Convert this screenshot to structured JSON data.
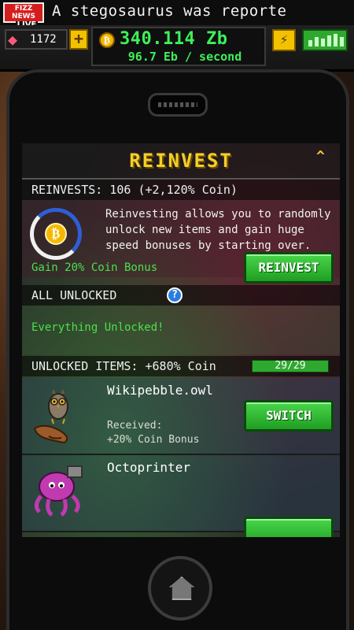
{
  "news": {
    "logo_top": "FIZZ NEWS",
    "logo_bottom": "LIVE",
    "ticker": "A stegosaurus was reporte"
  },
  "stats": {
    "gems": "1172",
    "plus": "+",
    "coin_total": "340.114 Zb",
    "coin_rate": "96.7 Eb / second",
    "boost_icon": "lightning-icon",
    "chart_icon": "bar-chart-icon"
  },
  "reinvest": {
    "title": "REINVEST",
    "collapse_symbol": "^",
    "count_label": "REINVESTS: 106 (+2,120% Coin)",
    "description": "Reinvesting allows you to randomly unlock new items and gain huge speed bonuses by starting over.",
    "gain": "Gain 20% Coin Bonus",
    "button": "REINVEST"
  },
  "all_unlocked": {
    "label": "ALL UNLOCKED",
    "help": "?",
    "status": "Everything Unlocked!"
  },
  "unlocked_items": {
    "label": "UNLOCKED ITEMS: +680% Coin",
    "progress": "29/29",
    "items": [
      {
        "name": "Wikipebble.owl",
        "received_label": "Received:",
        "bonus": "+20% Coin Bonus",
        "button": "SWITCH",
        "icon": "owl-icon"
      },
      {
        "name": "Octoprinter",
        "icon": "octopus-icon"
      }
    ]
  },
  "colors": {
    "accent_green": "#3df05a",
    "title_yellow": "#f3cf2a",
    "button_green": "#2fa82f"
  }
}
